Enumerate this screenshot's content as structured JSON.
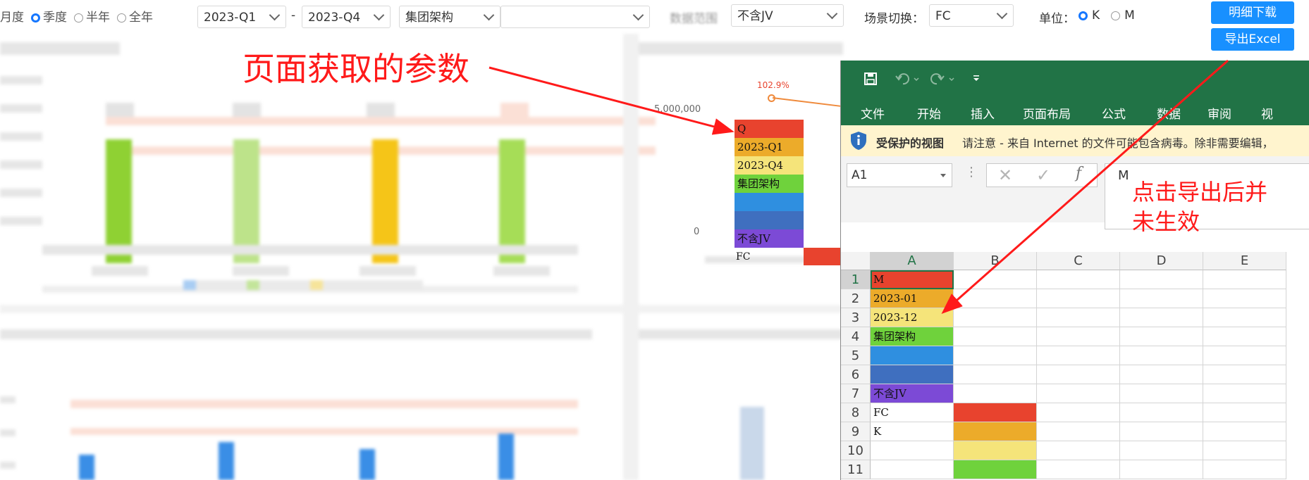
{
  "filters": {
    "period_options": [
      "月度",
      "季度",
      "半年",
      "全年"
    ],
    "period_selected": "季度",
    "start_quarter": "2023-Q1",
    "range_separator": "-",
    "end_quarter": "2023-Q4",
    "org": "集团架构",
    "data_range_label": "数据范围",
    "data_range_value": "不含JV",
    "scene_label": "场景切换：",
    "scene_value": "FC",
    "unit_label": "单位：",
    "unit_options": [
      "K",
      "M"
    ],
    "unit_selected": "K",
    "detail_button": "明细下载",
    "export_button": "导出Excel"
  },
  "annotations": {
    "page_params": "页面获取的参数",
    "export_note": "点击导出后并未生效"
  },
  "chart_overlay": {
    "pct_label": "102.9%",
    "y_tick_top": "5,000,000",
    "y_tick_zero": "0",
    "x_label": "FC",
    "stack_items": [
      "Q",
      "2023-Q1",
      "2023-Q4",
      "集团架构",
      "",
      "",
      "不含JV"
    ],
    "stack_colors": [
      "#e8432e",
      "#ecab2a",
      "#f5e47a",
      "#6fd23c",
      "#2f8fe0",
      "#3f6fbf",
      "#7c4ad6"
    ]
  },
  "excel": {
    "menu": [
      "文件",
      "开始",
      "插入",
      "页面布局",
      "公式",
      "数据",
      "审阅",
      "视"
    ],
    "warn_title": "受保护的视图",
    "warn_text": "请注意 - 来自 Internet 的文件可能包含病毒。除非需要编辑，",
    "name_box": "A1",
    "formula_value": "M",
    "columns": [
      "A",
      "B",
      "C",
      "D",
      "E"
    ],
    "rows": [
      "1",
      "2",
      "3",
      "4",
      "5",
      "6",
      "7",
      "8",
      "9",
      "10",
      "11"
    ],
    "col_a": [
      "M",
      "2023-01",
      "2023-12",
      "集团架构",
      "",
      "",
      "不含JV",
      "FC",
      "K",
      "",
      ""
    ],
    "col_a_colors": [
      "#e8432e",
      "#ecab2a",
      "#f5e47a",
      "#6fd23c",
      "#2f8fe0",
      "#3f6fbf",
      "#7c4ad6",
      "#ffffff",
      "#ffffff",
      "#ffffff",
      "#ffffff"
    ],
    "col_b_colors": [
      "",
      "",
      "",
      "",
      "",
      "",
      "",
      "#e8432e",
      "#ecab2a",
      "#f5e47a",
      "#6fd23c"
    ]
  }
}
